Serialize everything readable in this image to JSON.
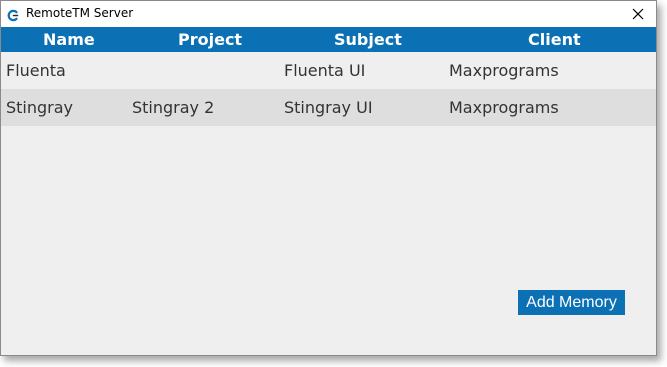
{
  "window": {
    "title": "RemoteTM Server",
    "app_icon": "remotetm-logo-icon",
    "close_icon": "close-icon"
  },
  "table": {
    "columns": [
      "Name",
      "Project",
      "Subject",
      "Client"
    ],
    "rows": [
      {
        "name": "Fluenta",
        "project": "",
        "subject": "Fluenta UI",
        "client": "Maxprograms"
      },
      {
        "name": "Stingray",
        "project": "Stingray 2",
        "subject": "Stingray UI",
        "client": "Maxprograms"
      }
    ]
  },
  "actions": {
    "add_memory_label": "Add Memory"
  },
  "colors": {
    "accent": "#0b70b4",
    "background": "#efefef",
    "alt_row": "#dedede",
    "text": "#333333"
  }
}
